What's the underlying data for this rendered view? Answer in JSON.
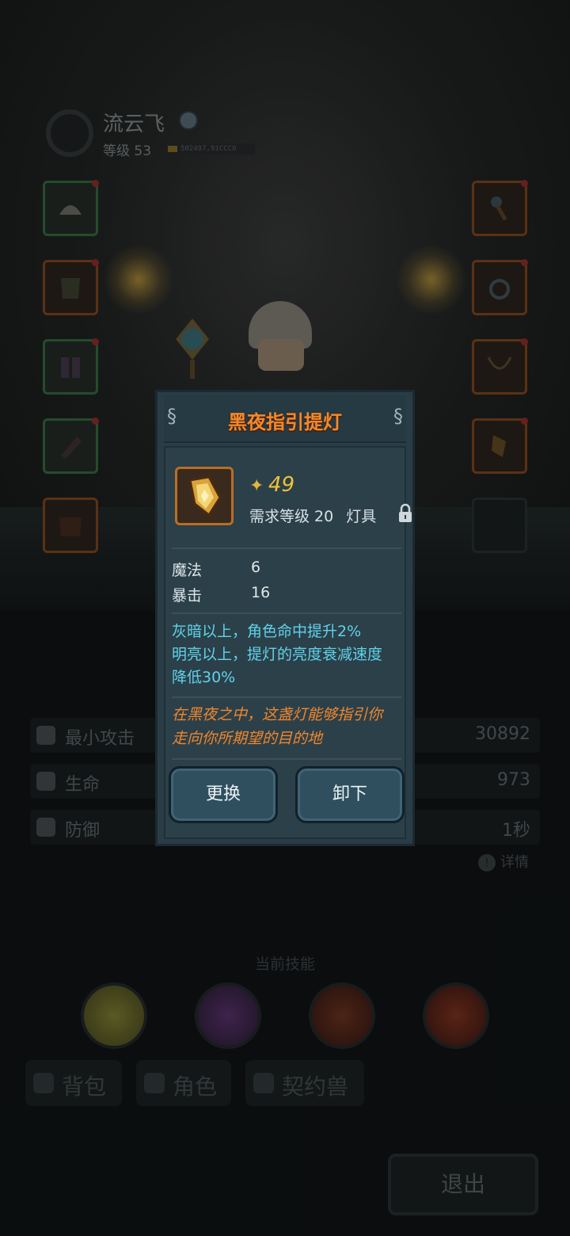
{
  "player": {
    "name": "流云飞",
    "level_text": "等级 53",
    "id_text": "502497,91CCC0"
  },
  "stats": [
    {
      "label": "最小攻击",
      "value": "30892",
      "icon": "sword-icon"
    },
    {
      "label": "生命",
      "value": "973",
      "icon": "heart-icon"
    },
    {
      "label": "防御",
      "value": "1秒",
      "icon": "shield-icon"
    }
  ],
  "details_label": "详情",
  "skills_title": "当前技能",
  "tabs": [
    {
      "label": "背包",
      "icon": "bag-icon"
    },
    {
      "label": "角色",
      "icon": "character-icon"
    },
    {
      "label": "契约兽",
      "icon": "paw-icon"
    }
  ],
  "exit_label": "退出",
  "item_dialog": {
    "title": "黑夜指引提灯",
    "power": "49",
    "requirement": "需求等级 20",
    "item_type": "灯具",
    "attributes": [
      {
        "label": "魔法",
        "value": "6"
      },
      {
        "label": "暴击",
        "value": "16"
      }
    ],
    "effect_lines": [
      "灰暗以上，角色命中提升2%",
      "明亮以上，提灯的亮度衰减速度",
      "降低30%"
    ],
    "lore_lines": [
      "在黑夜之中，这盏灯能够指引你",
      "走向你所期望的目的地"
    ],
    "replace_label": "更换",
    "unequip_label": "卸下"
  },
  "colors": {
    "title_orange": "#f08a2e",
    "effect_cyan": "#5fd3ea",
    "power_gold": "#f0c239",
    "panel": "#2a3d46"
  }
}
